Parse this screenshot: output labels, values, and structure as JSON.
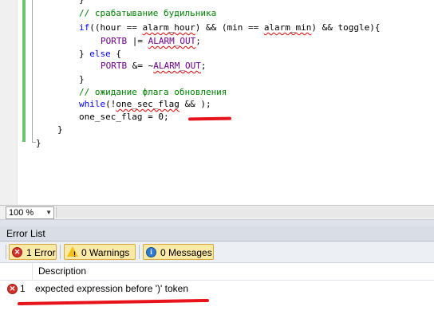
{
  "editor": {
    "code_lines": [
      {
        "indent": "    ",
        "parts": [
          {
            "t": "}",
            "c": "tx"
          }
        ]
      },
      {
        "indent": "    ",
        "parts": [
          {
            "t": "// срабатывание будильника",
            "c": "cm"
          }
        ]
      },
      {
        "indent": "    ",
        "parts": [
          {
            "t": "if",
            "c": "kw"
          },
          {
            "t": "((hour == ",
            "c": "tx"
          },
          {
            "t": "alarm_hour",
            "c": "sq"
          },
          {
            "t": ") && (min == ",
            "c": "tx"
          },
          {
            "t": "alarm_min",
            "c": "sq"
          },
          {
            "t": ") && toggle){",
            "c": "tx"
          }
        ]
      },
      {
        "indent": "        ",
        "parts": [
          {
            "t": "PORTB",
            "c": "mc"
          },
          {
            "t": " |= ",
            "c": "tx"
          },
          {
            "t": "ALARM_OUT",
            "c": "mcsq"
          },
          {
            "t": ";",
            "c": "tx"
          }
        ]
      },
      {
        "indent": "    ",
        "parts": [
          {
            "t": "} ",
            "c": "tx"
          },
          {
            "t": "else",
            "c": "kw"
          },
          {
            "t": " {",
            "c": "tx"
          }
        ]
      },
      {
        "indent": "        ",
        "parts": [
          {
            "t": "PORTB",
            "c": "mc"
          },
          {
            "t": " &= ~",
            "c": "tx"
          },
          {
            "t": "ALARM_OUT",
            "c": "mcsq"
          },
          {
            "t": ";",
            "c": "tx"
          }
        ]
      },
      {
        "indent": "    ",
        "parts": [
          {
            "t": "}",
            "c": "tx"
          }
        ]
      },
      {
        "indent": "    ",
        "parts": [
          {
            "t": "// ожидание флага обновления",
            "c": "cm"
          }
        ]
      },
      {
        "indent": "    ",
        "parts": [
          {
            "t": "while",
            "c": "kw"
          },
          {
            "t": "(!",
            "c": "tx"
          },
          {
            "t": "one_sec_flag",
            "c": "sq"
          },
          {
            "t": " && );",
            "c": "tx"
          }
        ]
      },
      {
        "indent": "    ",
        "parts": [
          {
            "t": "one_sec_flag = 0;",
            "c": "tx"
          }
        ]
      },
      {
        "indent": "",
        "parts": [
          {
            "t": "}",
            "c": "tx"
          }
        ]
      },
      {
        "indent": "",
        "parts": [
          {
            "t": "}",
            "c": "tx"
          }
        ]
      }
    ]
  },
  "zoom": {
    "value": "100 %"
  },
  "error_list": {
    "title": "Error List",
    "filters": {
      "errors_label": "1 Error",
      "warnings_label": "0 Warnings",
      "messages_label": "0 Messages"
    },
    "columns": {
      "description": "Description"
    },
    "rows": [
      {
        "num": "1",
        "description": "expected expression before ')' token"
      }
    ]
  },
  "colors": {
    "keyword": "#0000ff",
    "comment": "#008000",
    "macro": "#6f008a",
    "error_mark": "#e8141c",
    "toolbar_active": "#fbe9a8"
  }
}
